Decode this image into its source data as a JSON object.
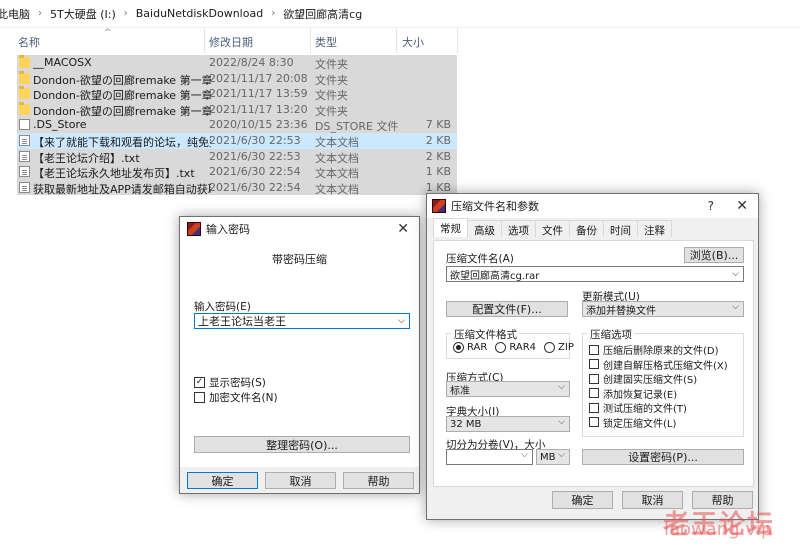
{
  "breadcrumb": [
    "此电脑",
    "5T大硬盘 (I:)",
    "BaiduNetdiskDownload",
    "欲望回廊高清cg"
  ],
  "columns": {
    "name": "名称",
    "date": "修改日期",
    "type": "类型",
    "size": "大小"
  },
  "files": [
    {
      "name": "__MACOSX",
      "date": "2022/8/24 8:30",
      "type": "文件夹",
      "size": "",
      "icon": "folder-icon",
      "state": "selg"
    },
    {
      "name": "Dondon-欲望の回廊remake 第一章 淫...",
      "date": "2021/11/17 20:08",
      "type": "文件夹",
      "size": "",
      "icon": "folder-icon",
      "state": "selg"
    },
    {
      "name": "Dondon-欲望の回廊remake 第一章 淫...",
      "date": "2021/11/17 13:59",
      "type": "文件夹",
      "size": "",
      "icon": "folder-icon",
      "state": "selg"
    },
    {
      "name": "Dondon-欲望の回廊remake 第一章 淫...",
      "date": "2021/11/17 13:20",
      "type": "文件夹",
      "size": "",
      "icon": "folder-icon",
      "state": "selg"
    },
    {
      "name": ".DS_Store",
      "date": "2020/10/15 23:36",
      "type": "DS_STORE 文件",
      "size": "7 KB",
      "icon": "blank-file-icon",
      "state": "selg"
    },
    {
      "name": "【来了就能下载和观看的论坛，纯免费!...",
      "date": "2021/6/30 22:53",
      "type": "文本文档",
      "size": "2 KB",
      "icon": "text-file-icon",
      "state": "sel"
    },
    {
      "name": "【老王论坛介绍】.txt",
      "date": "2021/6/30 22:53",
      "type": "文本文档",
      "size": "2 KB",
      "icon": "text-file-icon",
      "state": "selg"
    },
    {
      "name": "【老王论坛永久地址发布页】.txt",
      "date": "2021/6/30 22:54",
      "type": "文本文档",
      "size": "1 KB",
      "icon": "text-file-icon",
      "state": "selg"
    },
    {
      "name": "获取最新地址及APP请发邮箱自动获取.txt",
      "date": "2021/6/30 22:54",
      "type": "文本文档",
      "size": "1 KB",
      "icon": "text-file-icon",
      "state": "selg"
    }
  ],
  "pwd": {
    "title": "输入密码",
    "heading": "带密码压缩",
    "label": "输入密码(E)",
    "value": "上老王论坛当老王",
    "show_pwd": "显示密码(S)",
    "enc_names": "加密文件名(N)",
    "organize": "整理密码(O)...",
    "ok": "确定",
    "cancel": "取消",
    "help": "帮助"
  },
  "rar": {
    "title": "压缩文件名和参数",
    "help": "?",
    "tabs": [
      "常规",
      "高级",
      "选项",
      "文件",
      "备份",
      "时间",
      "注释"
    ],
    "archive_label": "压缩文件名(A)",
    "browse": "浏览(B)...",
    "archive_value": "欲望回廊高清cg.rar",
    "profile": "配置文件(F)...",
    "update_label": "更新模式(U)",
    "update_value": "添加并替换文件",
    "format_label": "压缩文件格式",
    "formats": [
      "RAR",
      "RAR4",
      "ZIP"
    ],
    "method_label": "压缩方式(C)",
    "method_value": "标准",
    "dict_label": "字典大小(I)",
    "dict_value": "32 MB",
    "split_label": "切分为分卷(V)，大小",
    "split_value": "",
    "split_unit": "MB",
    "options_label": "压缩选项",
    "options": [
      "压缩后删除原来的文件(D)",
      "创建自解压格式压缩文件(X)",
      "创建固实压缩文件(S)",
      "添加恢复记录(E)",
      "测试压缩的文件(T)",
      "锁定压缩文件(L)"
    ],
    "set_pwd": "设置密码(P)...",
    "ok": "确定",
    "cancel": "取消",
    "help_btn": "帮助"
  },
  "watermark": {
    "cn": "老王论坛",
    "url": "laowang.vip"
  }
}
